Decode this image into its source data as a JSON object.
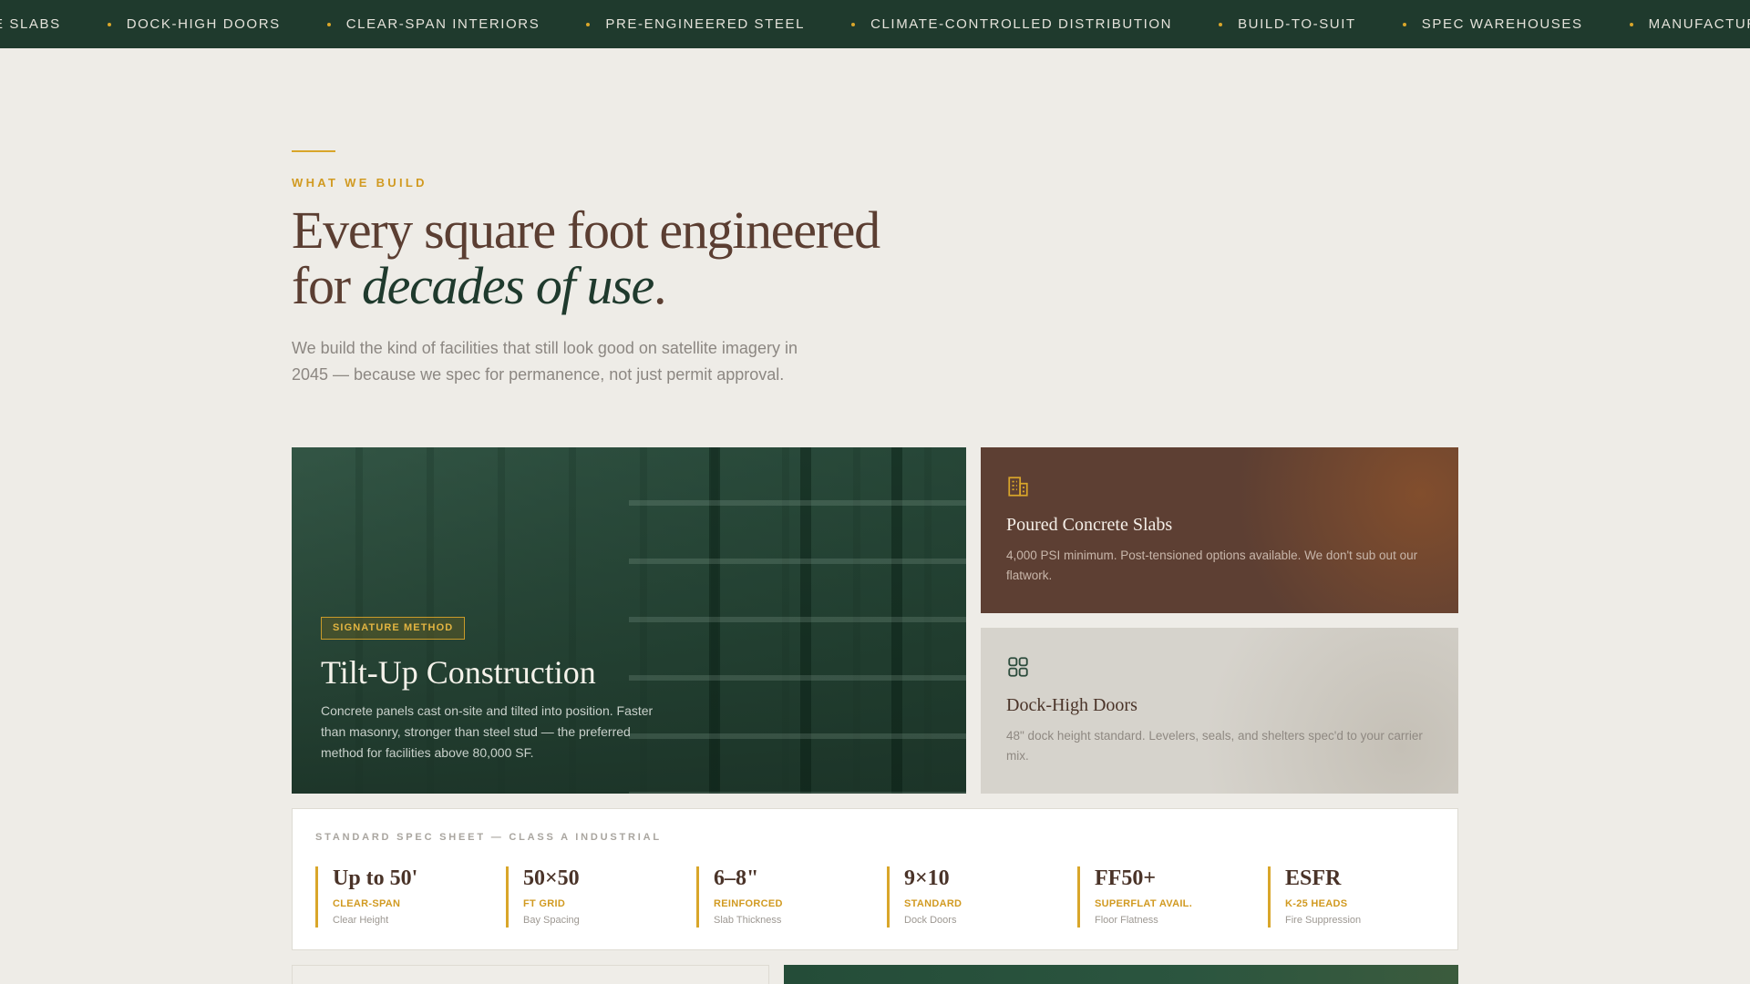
{
  "marquee": {
    "items": [
      "E SLABS",
      "DOCK-HIGH DOORS",
      "CLEAR-SPAN INTERIORS",
      "PRE-ENGINEERED STEEL",
      "CLIMATE-CONTROLLED DISTRIBUTION",
      "BUILD-TO-SUIT",
      "SPEC WAREHOUSES",
      "MANUFACTURING FACILITIES"
    ]
  },
  "section": {
    "eyebrow": "WHAT WE BUILD",
    "headline_line1": "Every square foot engineered",
    "headline_for": "for ",
    "headline_italic": "decades of use",
    "headline_period": ".",
    "lead": "We build the kind of facilities that still look good on satellite imagery in 2045 — because we spec for permanence, not just permit approval."
  },
  "hero_card": {
    "badge": "SIGNATURE METHOD",
    "title": "Tilt-Up Construction",
    "description": "Concrete panels cast on-site and tilted into position. Faster than masonry, stronger than steel stud — the preferred method for facilities above 80,000 SF."
  },
  "slabs_card": {
    "icon": "building-icon",
    "title": "Poured Concrete Slabs",
    "description": "4,000 PSI minimum. Post-tensioned options available. We don't sub out our flatwork."
  },
  "doors_card": {
    "icon": "grid-icon",
    "title": "Dock-High Doors",
    "description": "48\" dock height standard. Levelers, seals, and shelters spec'd to your carrier mix."
  },
  "spec_sheet": {
    "label": "STANDARD SPEC SHEET — CLASS A INDUSTRIAL",
    "items": [
      {
        "value": "Up to 50'",
        "sub": "CLEAR-SPAN",
        "desc": "Clear Height"
      },
      {
        "value": "50×50",
        "sub": "FT GRID",
        "desc": "Bay Spacing"
      },
      {
        "value": "6–8\"",
        "sub": "REINFORCED",
        "desc": "Slab Thickness"
      },
      {
        "value": "9×10",
        "sub": "STANDARD",
        "desc": "Dock Doors"
      },
      {
        "value": "FF50+",
        "sub": "SUPERFLAT AVAIL.",
        "desc": "Floor Flatness"
      },
      {
        "value": "ESFR",
        "sub": "K-25 HEADS",
        "desc": "Fire Suppression"
      }
    ]
  },
  "colors": {
    "forest": "#1f3a2d",
    "gold": "#d9a62a",
    "brown": "#5d3f33",
    "background": "#eeece7"
  }
}
